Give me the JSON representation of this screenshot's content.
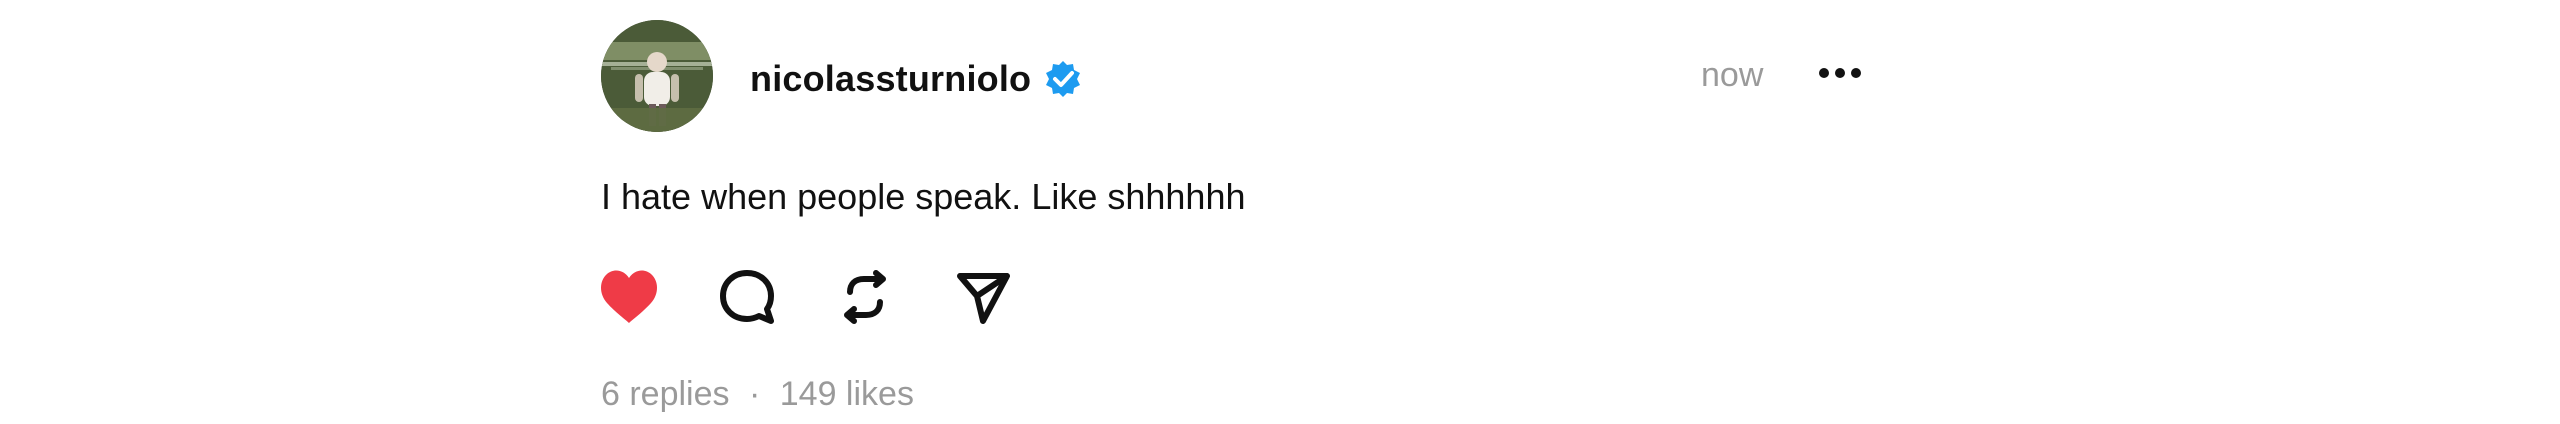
{
  "post": {
    "username": "nicolassturniolo",
    "timestamp": "now",
    "text": "I hate when people speak. Like shhhhhh",
    "stats": {
      "replies": "6 replies",
      "separator": "·",
      "likes": "149 likes"
    }
  },
  "icons": {
    "verified": "verified-badge-icon",
    "more": "more-options-icon",
    "like": "heart-icon",
    "reply": "comment-icon",
    "repost": "repost-icon",
    "share": "send-icon"
  },
  "colors": {
    "text": "#111111",
    "muted": "#9a9a9a",
    "like": "#ef3b47",
    "verified": "#1d9bf0",
    "background": "#ffffff"
  }
}
